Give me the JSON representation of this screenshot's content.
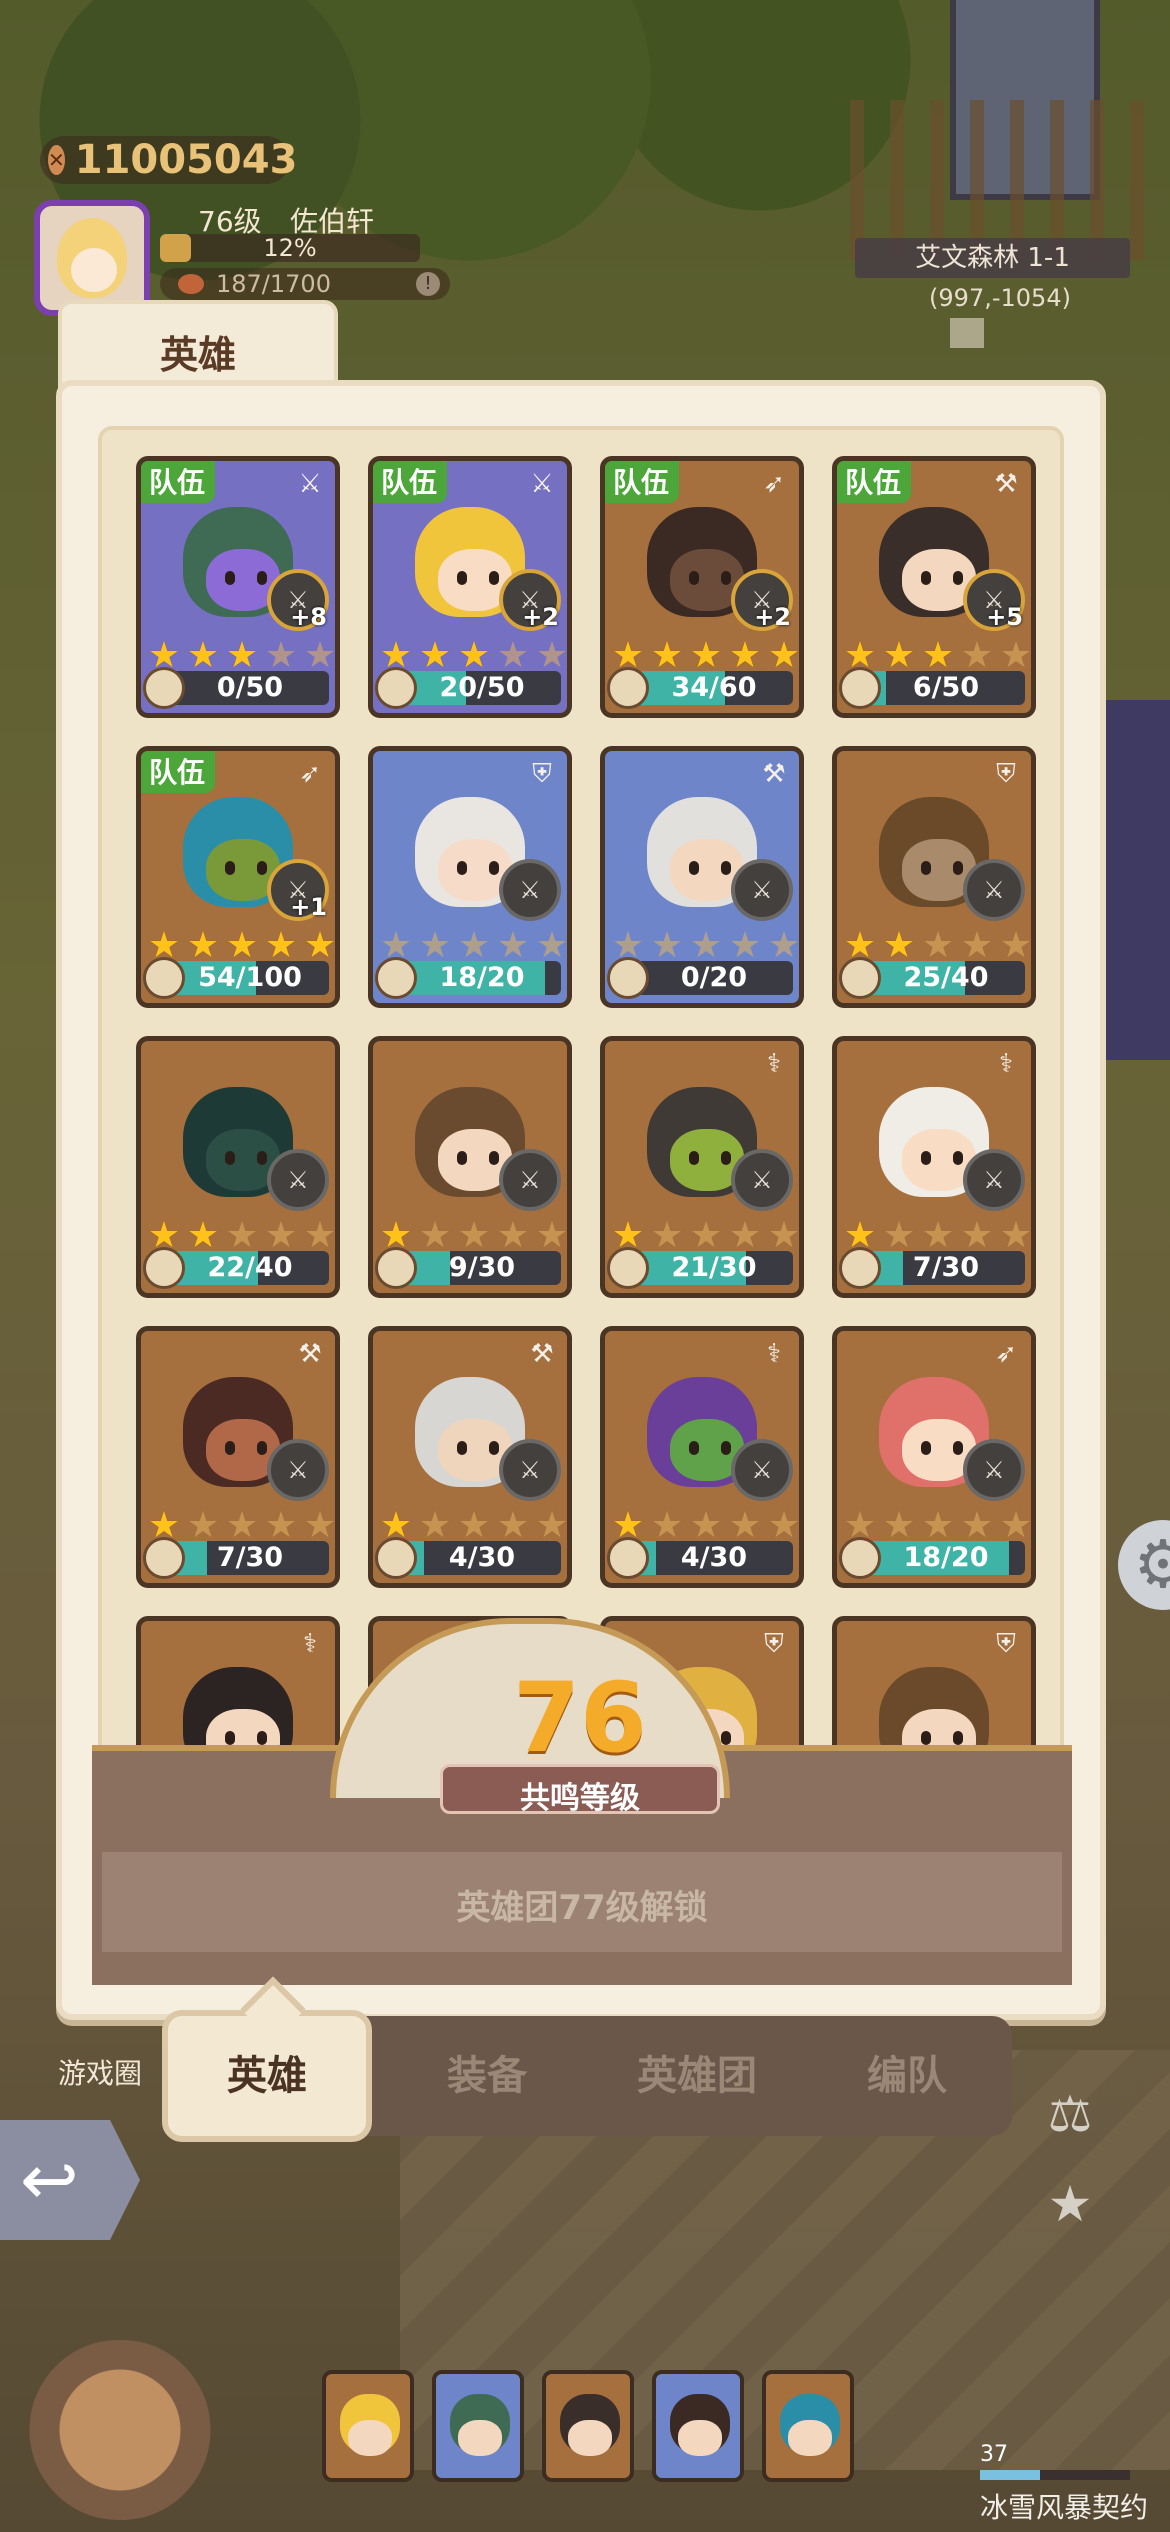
{
  "hud": {
    "coins": "11005043",
    "level": "76级",
    "name": "佐伯轩",
    "xp_percent_label": "12%",
    "xp_fraction": 0.12,
    "stamina": "187/1700",
    "location": "艾文森林 1-1",
    "coordinates": "(997,-1054)"
  },
  "panel": {
    "title_tab": "英雄"
  },
  "heroes": [
    {
      "team_badge": "队伍",
      "class_icon": "sword-class-icon",
      "enhance": "+8",
      "stars": 3,
      "progress": "0/50",
      "ratio": 0.0,
      "card_color": "purple",
      "hair": "#3f6b55",
      "skin": "#8c6bd6"
    },
    {
      "team_badge": "队伍",
      "class_icon": "sword-class-icon",
      "enhance": "+2",
      "stars": 3,
      "progress": "20/50",
      "ratio": 0.4,
      "card_color": "purple",
      "hair": "#f0c53b",
      "skin": "#f8dcc4"
    },
    {
      "team_badge": "队伍",
      "class_icon": "bow-class-icon",
      "enhance": "+2",
      "stars": 5,
      "progress": "34/60",
      "ratio": 0.57,
      "card_color": "brown",
      "hair": "#3b2a23",
      "skin": "#6b4b3a"
    },
    {
      "team_badge": "队伍",
      "class_icon": "axe-class-icon",
      "enhance": "+5",
      "stars": 3,
      "progress": "6/50",
      "ratio": 0.12,
      "card_color": "brown",
      "hair": "#3a2e2a",
      "skin": "#f3d7be"
    },
    {
      "team_badge": "队伍",
      "class_icon": "bow-class-icon",
      "enhance": "+1",
      "stars": 5,
      "progress": "54/100",
      "ratio": 0.54,
      "card_color": "brown",
      "hair": "#2a8ea8",
      "skin": "#7a9a3a"
    },
    {
      "team_badge": "",
      "class_icon": "shield-class-icon",
      "enhance": "",
      "stars": 0,
      "progress": "18/20",
      "ratio": 0.9,
      "card_color": "blue",
      "hair": "#e9e6e2",
      "skin": "#f6dcc8"
    },
    {
      "team_badge": "",
      "class_icon": "axe-class-icon",
      "enhance": "",
      "stars": 0,
      "progress": "0/20",
      "ratio": 0.0,
      "card_color": "blue",
      "hair": "#e2e0dc",
      "skin": "#f3d7be"
    },
    {
      "team_badge": "",
      "class_icon": "shield-class-icon",
      "enhance": "",
      "stars": 2,
      "progress": "25/40",
      "ratio": 0.62,
      "card_color": "brown",
      "hair": "#6b4a2a",
      "skin": "#a98a6a"
    },
    {
      "team_badge": "",
      "class_icon": "",
      "enhance": "",
      "stars": 2,
      "progress": "22/40",
      "ratio": 0.55,
      "card_color": "brown",
      "hair": "#1e3a36",
      "skin": "#2b4f45"
    },
    {
      "team_badge": "",
      "class_icon": "",
      "enhance": "",
      "stars": 1,
      "progress": "9/30",
      "ratio": 0.3,
      "card_color": "brown",
      "hair": "#6a4b2f",
      "skin": "#f3d7be"
    },
    {
      "team_badge": "",
      "class_icon": "staff-class-icon",
      "enhance": "",
      "stars": 1,
      "progress": "21/30",
      "ratio": 0.7,
      "card_color": "brown",
      "hair": "#3f3a36",
      "skin": "#8fb03c"
    },
    {
      "team_badge": "",
      "class_icon": "staff-class-icon",
      "enhance": "",
      "stars": 1,
      "progress": "7/30",
      "ratio": 0.23,
      "card_color": "brown",
      "hair": "#f0ede6",
      "skin": "#f8dcc4"
    },
    {
      "team_badge": "",
      "class_icon": "axe-class-icon",
      "enhance": "",
      "stars": 1,
      "progress": "7/30",
      "ratio": 0.23,
      "card_color": "brown",
      "hair": "#4a2a22",
      "skin": "#b06848"
    },
    {
      "team_badge": "",
      "class_icon": "axe-class-icon",
      "enhance": "",
      "stars": 1,
      "progress": "4/30",
      "ratio": 0.13,
      "card_color": "brown",
      "hair": "#d8d6d2",
      "skin": "#f0d5bd"
    },
    {
      "team_badge": "",
      "class_icon": "staff-class-icon",
      "enhance": "",
      "stars": 1,
      "progress": "4/30",
      "ratio": 0.13,
      "card_color": "brown",
      "hair": "#6a3f9a",
      "skin": "#5fa24a"
    },
    {
      "team_badge": "",
      "class_icon": "bow-class-icon",
      "enhance": "",
      "stars": 0,
      "progress": "18/20",
      "ratio": 0.9,
      "card_color": "brown",
      "hair": "#e0706a",
      "skin": "#f8dcc4"
    },
    {
      "team_badge": "",
      "class_icon": "staff-class-icon",
      "enhance": "",
      "stars": 0,
      "progress": "",
      "ratio": 0.0,
      "card_color": "brown",
      "hair": "#2b2422",
      "skin": "#f3d7be"
    },
    {
      "team_badge": "",
      "class_icon": "",
      "enhance": "",
      "stars": 0,
      "progress": "",
      "ratio": 0.0,
      "card_color": "brown",
      "hair": "#3d5bb0",
      "skin": "#f3d7be"
    },
    {
      "team_badge": "",
      "class_icon": "shield-class-icon",
      "enhance": "",
      "stars": 0,
      "progress": "",
      "ratio": 0.0,
      "card_color": "brown",
      "hair": "#e0b040",
      "skin": "#f3d7be"
    },
    {
      "team_badge": "",
      "class_icon": "shield-class-icon",
      "enhance": "",
      "stars": 0,
      "progress": "",
      "ratio": 0.0,
      "card_color": "brown",
      "hair": "#6a4a2a",
      "skin": "#f3d7be"
    }
  ],
  "resonance": {
    "level": "76",
    "label": "共鸣等级",
    "unlock_text": "英雄团77级解锁"
  },
  "tabs": [
    "英雄",
    "装备",
    "英雄团",
    "编队"
  ],
  "side": {
    "game_circle": "游戏圈",
    "power": "37",
    "contract": "冰雪风暴契约"
  },
  "party_colors": [
    "#f0c53b",
    "#3f6b55",
    "#3a2e2a",
    "#3b2a23",
    "#2a8ea8"
  ]
}
